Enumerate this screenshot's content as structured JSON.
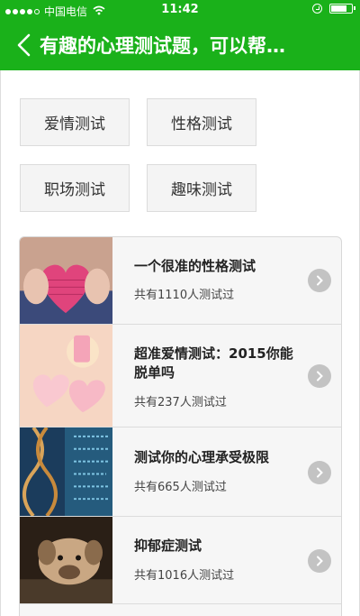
{
  "status": {
    "carrier": "中国电信",
    "time": "11:42",
    "signal_strength": 4,
    "battery_level": 0.75
  },
  "nav": {
    "title": "有趣的心理测试题，可以帮…",
    "back_icon": "chevron-left-icon"
  },
  "categories": [
    {
      "label": "爱情测试"
    },
    {
      "label": "性格测试"
    },
    {
      "label": "职场测试"
    },
    {
      "label": "趣味测试"
    }
  ],
  "quizzes": [
    {
      "title": "一个很准的性格测试",
      "count": "共有1110人测试过",
      "thumbnail": "knitted-heart-photo"
    },
    {
      "title": "超准爱情测试：2015你能脱单吗",
      "count": "共有237人测试过",
      "thumbnail": "pink-hearts-photo"
    },
    {
      "title": "测试你的心理承受极限",
      "count": "共有665人测试过",
      "thumbnail": "dna-photo"
    },
    {
      "title": "抑郁症测试",
      "count": "共有1016人测试过",
      "thumbnail": "sad-dog-photo"
    }
  ],
  "colors": {
    "brand_green": "#1ab11a",
    "arrow_gray": "#c3c3c3"
  }
}
